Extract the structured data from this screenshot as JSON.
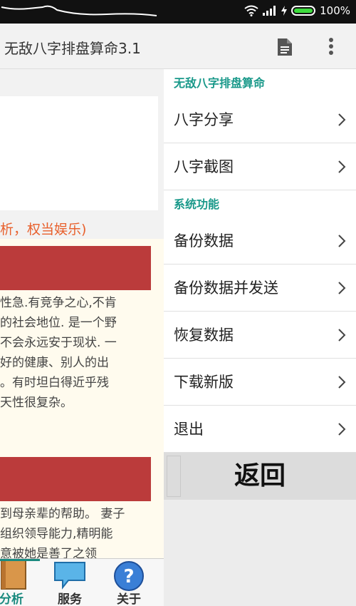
{
  "status_bar": {
    "battery": "100%",
    "battery_level": 1.0
  },
  "app_bar": {
    "title": "无敌八字排盘算命3.1",
    "icons": [
      "document-icon",
      "more-vert-icon"
    ]
  },
  "background": {
    "heading": "析，权当娱乐)",
    "paragraph1": [
      "性急.有竞争之心,不肯",
      "的社会地位. 是一个野",
      "不会永远安于现状. 一",
      "好的健康、别人的出",
      "。有时坦白得近乎残",
      "天性很复杂。"
    ],
    "paragraph2": [
      "到母亲辈的帮助。 妻子",
      "组织领导能力,精明能",
      "意被她是善了之领"
    ]
  },
  "bottom_nav": {
    "items": [
      {
        "label": "分析",
        "icon": "book-icon"
      },
      {
        "label": "服务",
        "icon": "chat-bubble-icon"
      },
      {
        "label": "关于",
        "icon": "help-icon"
      }
    ]
  },
  "drawer": {
    "section1": "无敌八字排盘算命",
    "items1": [
      "八字分享",
      "八字截图"
    ],
    "section2": "系统功能",
    "items2": [
      "备份数据",
      "备份数据并发送",
      "恢复数据",
      "下载新版",
      "退出"
    ],
    "back_label": "返回"
  },
  "colors": {
    "accent": "#1a998a",
    "heading_orange": "#e8602c",
    "red_bar": "#bb3b3b",
    "status_bg": "#111111"
  }
}
